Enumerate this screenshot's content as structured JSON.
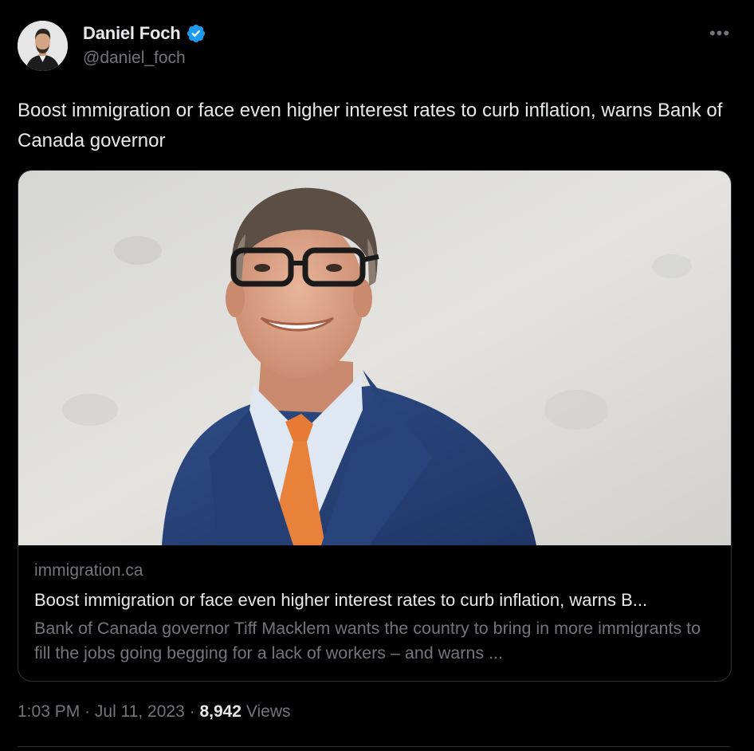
{
  "author": {
    "name": "Daniel Foch",
    "handle": "@daniel_foch",
    "verified": true,
    "verified_icon": "verified-badge-icon",
    "verified_color": "#1d9bf0"
  },
  "more_icon": "more-options-icon",
  "more_glyph": "•••",
  "tweet": {
    "text": "Boost immigration or face even higher interest rates to curb inflation, warns Bank of Canada governor"
  },
  "card": {
    "domain": "immigration.ca",
    "title": "Boost immigration or face even higher interest rates to curb inflation, warns B...",
    "description": "Bank of Canada governor Tiff Macklem wants the country to bring in more immigrants to fill the jobs going begging for a lack of workers – and warns ..."
  },
  "meta": {
    "time": "1:03 PM",
    "separator": " · ",
    "date": "Jul 11, 2023",
    "views_count": "8,942",
    "views_label": "Views"
  },
  "colors": {
    "background": "#000000",
    "primary_text": "#e7e9ea",
    "secondary_text": "#71767b",
    "border": "#2f3336",
    "accent": "#1d9bf0"
  }
}
